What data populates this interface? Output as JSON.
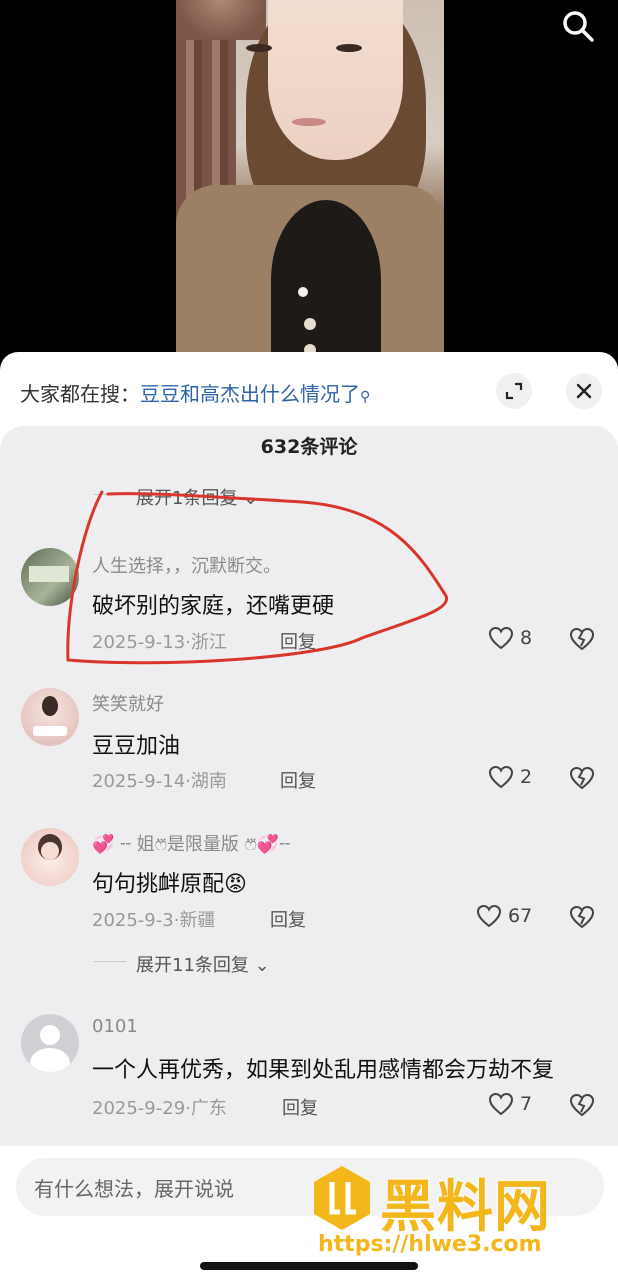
{
  "search_bar": {
    "prefix": "大家都在搜：",
    "query": "豆豆和高杰出什么情况了"
  },
  "comment_count": "632条评论",
  "expand_top": "展开1条回复",
  "comments": [
    {
      "user": "人生选择，，沉默断交。",
      "text": "破坏别的家庭，还嘴更硬",
      "date_loc": "2025-9-13·浙江",
      "reply": "回复",
      "likes": "8"
    },
    {
      "user": "笑笑就好",
      "text": "豆豆加油",
      "date_loc": "2025-9-14·湖南",
      "reply": "回复",
      "likes": "2"
    },
    {
      "user": "💞 ╌ 姐ෆ⃛是限量版 ෆ⃛💞╌",
      "text": "句句挑衅原配😡",
      "date_loc": "2025-9-3·新疆",
      "reply": "回复",
      "likes": "67"
    },
    {
      "user": "0101",
      "text": "一个人再优秀，如果到处乱用感情都会万劫不复",
      "date_loc": "2025-9-29·广东",
      "reply": "回复",
      "likes": "7"
    }
  ],
  "expand_middle": "展开11条回复",
  "input_placeholder": "有什么想法，展开说说",
  "watermark": {
    "title": "黑料网",
    "url": "https://hlwe3.com"
  },
  "colors": {
    "accent_link": "#2f63a8",
    "annotation_red": "#d9362b",
    "watermark": "#f3b61b"
  }
}
